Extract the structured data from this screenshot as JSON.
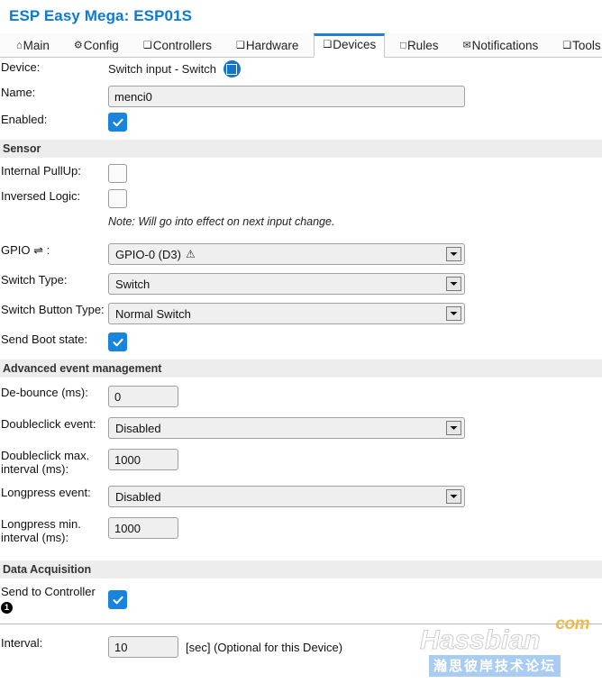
{
  "header": {
    "title": "ESP Easy Mega: ESP01S",
    "title_color": "#0c7ad6"
  },
  "tabs": [
    {
      "label": "Main",
      "icon": "home-icon",
      "glyph": "⌂",
      "active": false
    },
    {
      "label": "Config",
      "icon": "gear-icon",
      "glyph": "⚙",
      "active": false
    },
    {
      "label": "Controllers",
      "icon": "box-icon",
      "glyph": "❑",
      "active": false
    },
    {
      "label": "Hardware",
      "icon": "box-icon",
      "glyph": "❑",
      "active": false
    },
    {
      "label": "Devices",
      "icon": "box-icon",
      "glyph": "❑",
      "active": true
    },
    {
      "label": "Rules",
      "icon": "square-icon",
      "glyph": "□",
      "active": false
    },
    {
      "label": "Notifications",
      "icon": "envelope-icon",
      "glyph": "✉",
      "active": false
    },
    {
      "label": "Tools",
      "icon": "box-icon",
      "glyph": "❑",
      "active": false
    }
  ],
  "form": {
    "device": {
      "label": "Device:",
      "value": "Switch input - Switch",
      "icon": "device-status-icon"
    },
    "name": {
      "label": "Name:",
      "value": "menci0",
      "placeholder": ""
    },
    "enabled": {
      "label": "Enabled:",
      "checked": true
    }
  },
  "sensor": {
    "section_title": "Sensor",
    "internal_pullup": {
      "label": "Internal PullUp:",
      "checked": false
    },
    "inversed_logic": {
      "label": "Inversed Logic:",
      "checked": false
    },
    "note": "Note: Will go into effect on next input change.",
    "gpio": {
      "label": "GPIO ⇌ :",
      "value": "GPIO-0 (D3)",
      "warning_glyph": "⚠"
    },
    "switch_type": {
      "label": "Switch Type:",
      "value": "Switch"
    },
    "switch_button_type": {
      "label": "Switch Button Type:",
      "value": "Normal Switch"
    },
    "send_boot_state": {
      "label": "Send Boot state:",
      "checked": true
    }
  },
  "advanced": {
    "section_title": "Advanced event management",
    "debounce": {
      "label": "De-bounce (ms):",
      "value": "0"
    },
    "doubleclick_event": {
      "label": "Doubleclick event:",
      "value": "Disabled"
    },
    "doubleclick_interval": {
      "label": "Doubleclick max. interval (ms):",
      "value": "1000"
    },
    "longpress_event": {
      "label": "Longpress event:",
      "value": "Disabled"
    },
    "longpress_interval": {
      "label": "Longpress min. interval (ms):",
      "value": "1000"
    }
  },
  "data_acquisition": {
    "section_title": "Data Acquisition",
    "send_to_controller": {
      "label": "Send to Controller",
      "badge": "1",
      "checked": true
    },
    "interval": {
      "label": "Interval:",
      "value": "10",
      "note": "[sec] (Optional for this Device)"
    }
  },
  "watermark": {
    "com": "com",
    "name": "Hassbian",
    "chinese": "瀚思彼岸技术论坛"
  }
}
